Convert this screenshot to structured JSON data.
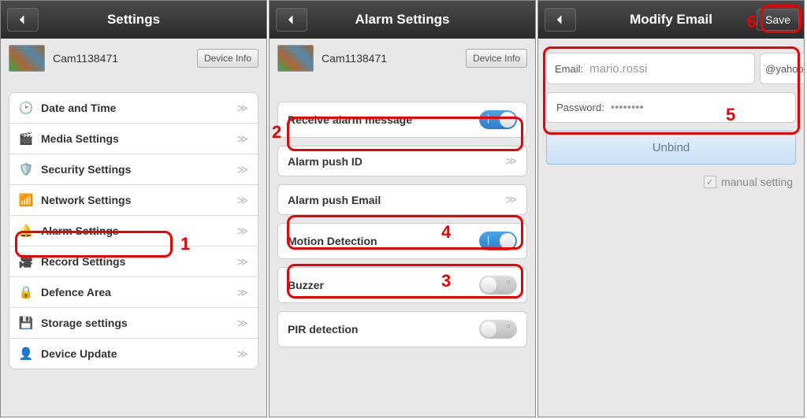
{
  "panel1": {
    "title": "Settings",
    "cam_name": "Cam1138471",
    "device_info": "Device Info",
    "items": [
      {
        "label": "Date and Time",
        "icon": "🕑"
      },
      {
        "label": "Media Settings",
        "icon": "🎬"
      },
      {
        "label": "Security Settings",
        "icon": "🛡️"
      },
      {
        "label": "Network Settings",
        "icon": "📶"
      },
      {
        "label": "Alarm Settings",
        "icon": "🔔"
      },
      {
        "label": "Record Settings",
        "icon": "🎥"
      },
      {
        "label": "Defence Area",
        "icon": "🔒"
      },
      {
        "label": "Storage settings",
        "icon": "💾"
      },
      {
        "label": "Device Update",
        "icon": "👤"
      }
    ]
  },
  "panel2": {
    "title": "Alarm Settings",
    "cam_name": "Cam1138471",
    "device_info": "Device Info",
    "rows": {
      "receive": "Receive alarm message",
      "push_id": "Alarm push ID",
      "push_email": "Alarm push Email",
      "motion": "Motion Detection",
      "buzzer": "Buzzer",
      "pir": "PIR detection"
    }
  },
  "panel3": {
    "title": "Modify Email",
    "save": "Save",
    "email_label": "Email:",
    "email_value": "mario.rossi",
    "domain": "@yahoo.it",
    "password_label": "Password:",
    "password_value": "••••••••",
    "unbind": "Unbind",
    "manual": "manual setting"
  },
  "annotations": {
    "n1": "1",
    "n2": "2",
    "n3": "3",
    "n4": "4",
    "n5": "5",
    "n6": "6"
  }
}
